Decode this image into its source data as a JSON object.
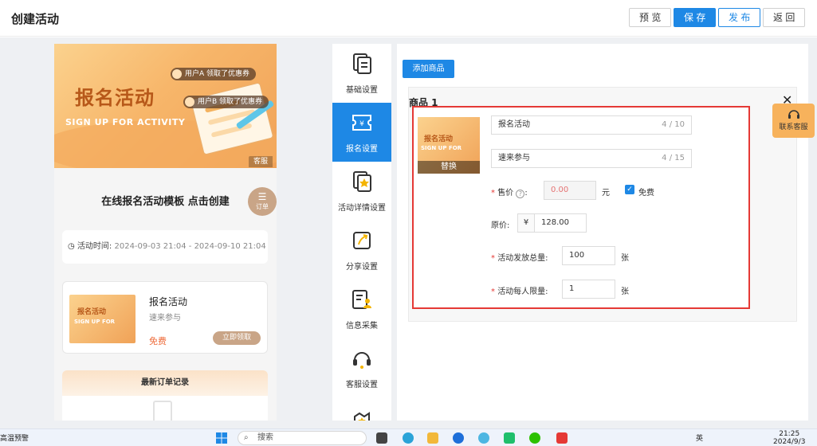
{
  "header": {
    "title": "创建活动",
    "buttons": {
      "preview": "预 览",
      "save": "保 存",
      "publish": "发 布",
      "back": "返 回"
    }
  },
  "preview": {
    "banner": {
      "title": "报名活动",
      "subtitle": "SIGN UP FOR ACTIVITY",
      "bubbles": [
        "用户A 领取了优惠券",
        "用户B 领取了优惠券"
      ],
      "service_tag": "客服"
    },
    "template_title": "在线报名活动模板 点击创建",
    "order_fab": {
      "icon": "list-icon",
      "label": "订单"
    },
    "time": {
      "label": "活动时间:",
      "value": "2024-09-03 21:04 - 2024-09-10 21:04"
    },
    "product": {
      "thumb_title": "报名活动",
      "thumb_sub": "SIGN UP FOR",
      "name": "报名活动",
      "desc": "速来参与",
      "price": "免费",
      "claim": "立即领取"
    },
    "orders_title": "最新订单记录"
  },
  "tabs": [
    {
      "label": "基础设置",
      "icon": "document-icon",
      "active": false
    },
    {
      "label": "报名设置",
      "icon": "ticket-icon",
      "active": true
    },
    {
      "label": "活动详情设置",
      "icon": "detail-doc-icon",
      "active": false
    },
    {
      "label": "分享设置",
      "icon": "share-icon",
      "active": false
    },
    {
      "label": "信息采集",
      "icon": "form-user-icon",
      "active": false
    },
    {
      "label": "客服设置",
      "icon": "headset-icon",
      "active": false
    }
  ],
  "editor": {
    "add_button": "添加商品",
    "goods_title": "商品 1",
    "close_icon": "close-icon",
    "image": {
      "thumb_title": "报名活动",
      "thumb_sub": "SIGN UP FOR",
      "replace": "替换"
    },
    "name": {
      "value": "报名活动",
      "count": "4 / 10"
    },
    "desc": {
      "value": "速来参与",
      "count": "4 / 15"
    },
    "price": {
      "label": "售价",
      "colon": ":",
      "value": "0.00",
      "unit": "元",
      "free_label": "免费",
      "free_checked": true
    },
    "original": {
      "label": "原价:",
      "prefix": "¥",
      "value": "128.00"
    },
    "total": {
      "label": "活动发放总量:",
      "value": "100",
      "unit": "张"
    },
    "limit": {
      "label": "活动每人限量:",
      "value": "1",
      "unit": "张"
    },
    "highlight_color": "#e53935"
  },
  "support": {
    "label": "联系客服",
    "icon": "headset-icon"
  },
  "taskbar": {
    "weather": "高温预警",
    "search": "搜索",
    "ime": "英",
    "time": "21:25",
    "date": "2024/9/3"
  },
  "colors": {
    "primary": "#1e88e5",
    "accent": "#f0a257",
    "price": "#ee6b3a"
  }
}
